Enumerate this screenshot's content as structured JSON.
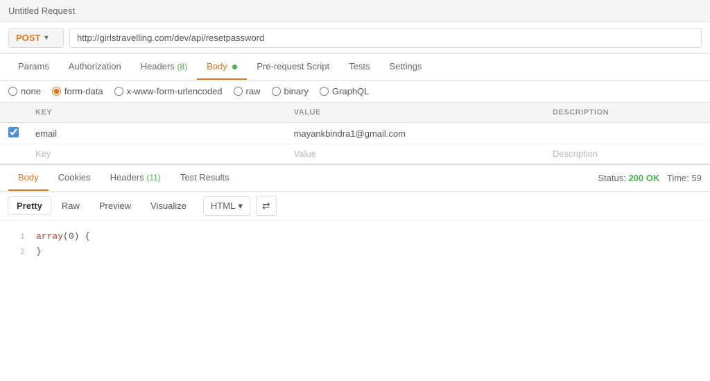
{
  "title": "Untitled Request",
  "urlBar": {
    "method": "POST",
    "url": "http://girlstravelling.com/dev/api/resetpassword",
    "chevron": "▾"
  },
  "requestTabs": [
    {
      "id": "params",
      "label": "Params",
      "active": false,
      "badge": null,
      "dot": false
    },
    {
      "id": "authorization",
      "label": "Authorization",
      "active": false,
      "badge": null,
      "dot": false
    },
    {
      "id": "headers",
      "label": "Headers",
      "active": false,
      "badge": "(8)",
      "dot": false
    },
    {
      "id": "body",
      "label": "Body",
      "active": true,
      "badge": null,
      "dot": true
    },
    {
      "id": "prerequest",
      "label": "Pre-request Script",
      "active": false,
      "badge": null,
      "dot": false
    },
    {
      "id": "tests",
      "label": "Tests",
      "active": false,
      "badge": null,
      "dot": false
    },
    {
      "id": "settings",
      "label": "Settings",
      "active": false,
      "badge": null,
      "dot": false
    }
  ],
  "bodyTypes": [
    {
      "id": "none",
      "label": "none",
      "checked": false
    },
    {
      "id": "form-data",
      "label": "form-data",
      "checked": true
    },
    {
      "id": "urlencoded",
      "label": "x-www-form-urlencoded",
      "checked": false
    },
    {
      "id": "raw",
      "label": "raw",
      "checked": false
    },
    {
      "id": "binary",
      "label": "binary",
      "checked": false
    },
    {
      "id": "graphql",
      "label": "GraphQL",
      "checked": false
    }
  ],
  "formTable": {
    "columns": [
      "KEY",
      "VALUE",
      "DESCRIPTION"
    ],
    "rows": [
      {
        "checked": true,
        "key": "email",
        "value": "mayankbindra1@gmail.com",
        "description": ""
      }
    ],
    "newRow": {
      "keyPlaceholder": "Key",
      "valuePlaceholder": "Value",
      "descPlaceholder": "Description"
    }
  },
  "responseTabs": [
    {
      "id": "body",
      "label": "Body",
      "active": true
    },
    {
      "id": "cookies",
      "label": "Cookies",
      "active": false
    },
    {
      "id": "headers",
      "label": "Headers",
      "badge": "(11)",
      "active": false
    },
    {
      "id": "testresults",
      "label": "Test Results",
      "active": false
    }
  ],
  "responseStatus": {
    "statusLabel": "Status:",
    "statusValue": "200 OK",
    "timeLabel": "Time:",
    "timeValue": "59"
  },
  "responseToolbar": {
    "tabs": [
      "Pretty",
      "Raw",
      "Preview",
      "Visualize"
    ],
    "activeTab": "Pretty",
    "format": "HTML",
    "chevron": "▾",
    "wrapIcon": "⇄"
  },
  "codeLines": [
    {
      "lineNum": "1",
      "content": "array(0) {"
    },
    {
      "lineNum": "2",
      "content": "}"
    }
  ]
}
